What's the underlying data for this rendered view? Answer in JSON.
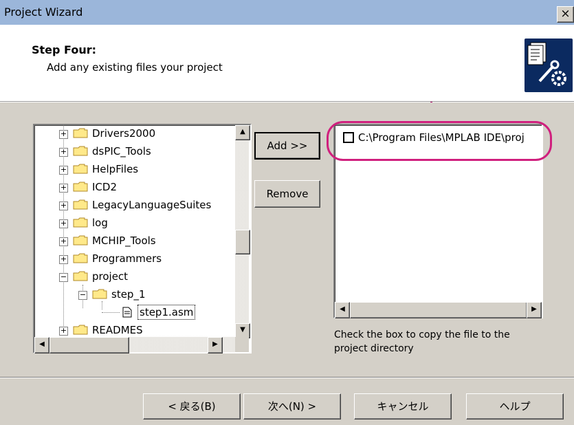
{
  "window": {
    "title": "Project Wizard",
    "close_label": "×"
  },
  "header": {
    "step_title": "Step Four:",
    "step_description": "Add any existing files your project"
  },
  "tree": {
    "items": [
      {
        "label": "Drivers2000",
        "expander": "+"
      },
      {
        "label": "dsPIC_Tools",
        "expander": "+"
      },
      {
        "label": "HelpFiles",
        "expander": "+"
      },
      {
        "label": "ICD2",
        "expander": "+"
      },
      {
        "label": "LegacyLanguageSuites",
        "expander": "+"
      },
      {
        "label": "log",
        "expander": "+"
      },
      {
        "label": "MCHIP_Tools",
        "expander": "+"
      },
      {
        "label": "Programmers",
        "expander": "+"
      },
      {
        "label": "project",
        "expander": "−"
      },
      {
        "label": "step_1",
        "expander": "−"
      },
      {
        "label": "step1.asm",
        "expander": ""
      },
      {
        "label": "READMES",
        "expander": "+"
      }
    ],
    "scroll_up": "▲",
    "scroll_down": "▼",
    "scroll_left": "◀",
    "scroll_right": "▶"
  },
  "buttons": {
    "add": "Add >>",
    "remove": "Remove"
  },
  "file_list": {
    "items": [
      {
        "path": "C:\\Program Files\\MPLAB IDE\\proj",
        "checked": false
      }
    ],
    "scroll_left": "◀",
    "scroll_right": "▶"
  },
  "note": "Check the box to copy the file to the project directory",
  "footer": {
    "back": "< 戻る(B)",
    "next": "次へ(N) >",
    "cancel": "キャンセル",
    "help": "ヘルプ"
  },
  "colors": {
    "titlebar": "#9bb6da",
    "dialog": "#d4d0c8",
    "callout": "#d0207e",
    "icon_bg": "#0b2a60"
  }
}
